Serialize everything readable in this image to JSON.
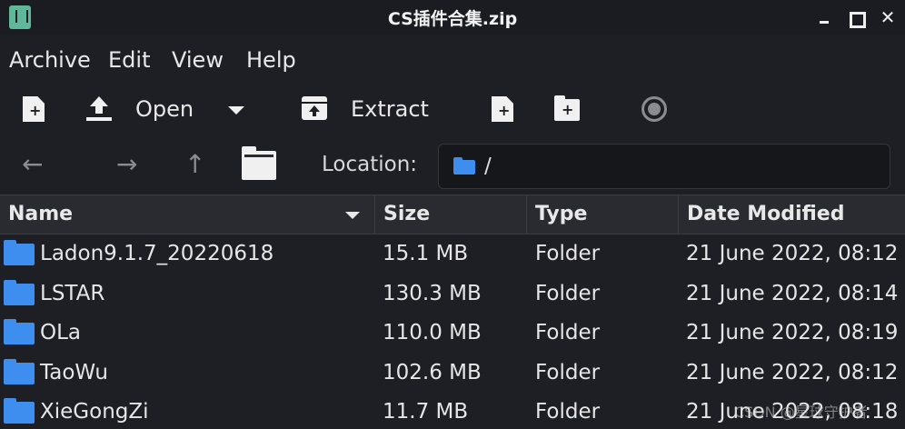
{
  "window": {
    "title": "CS插件合集.zip",
    "close_glyph": "✕"
  },
  "menu": [
    "Archive",
    "Edit",
    "View",
    "Help"
  ],
  "toolbar": {
    "open_label": "Open",
    "extract_label": "Extract"
  },
  "icons": {
    "app": "archive-manager-icon",
    "new": "new-archive-icon",
    "open": "upload-icon",
    "extract": "extract-icon",
    "add_files": "add-files-icon",
    "add_folder": "add-folder-icon",
    "stop": "stop-icon",
    "back": "back-arrow-icon",
    "forward": "forward-arrow-icon",
    "up": "up-arrow-icon",
    "home": "folder-icon"
  },
  "nav": {
    "back": "←",
    "forward": "→",
    "up": "↑",
    "location_label": "Location:",
    "location_value": "/"
  },
  "columns": [
    "Name",
    "Size",
    "Type",
    "Date Modified"
  ],
  "rows": [
    {
      "name": "Ladon9.1.7_20220618",
      "size": "15.1 MB",
      "type": "Folder",
      "date": "21 June 2022, 08:12"
    },
    {
      "name": "LSTAR",
      "size": "130.3 MB",
      "type": "Folder",
      "date": "21 June 2022, 08:14"
    },
    {
      "name": "OLa",
      "size": "110.0 MB",
      "type": "Folder",
      "date": "21 June 2022, 08:19"
    },
    {
      "name": "TaoWu",
      "size": "102.6 MB",
      "type": "Folder",
      "date": "21 June 2022, 08:12"
    },
    {
      "name": "XieGongZi",
      "size": "11.7 MB",
      "type": "Folder",
      "date": "21 June 2022, 08:18"
    }
  ],
  "watermark": "CSDN @星球守护者",
  "colors": {
    "background": "#1e1f24",
    "accent_folder": "#3e8ef0",
    "header": "#2a2b30",
    "text": "#e6e6e6"
  }
}
